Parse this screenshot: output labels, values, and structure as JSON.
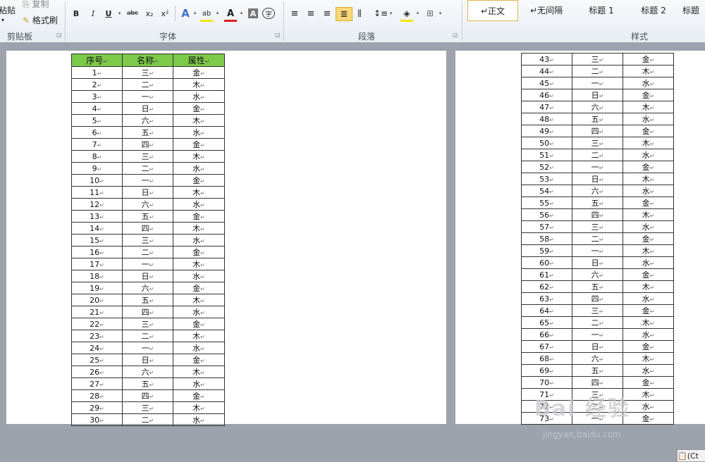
{
  "ribbon": {
    "clipboard": {
      "paste_label": "粘贴",
      "copy_label": "复制",
      "format_painter_label": "格式刷",
      "group_label": "剪贴板"
    },
    "font": {
      "group_label": "字体",
      "bold": "B",
      "italic": "I",
      "underline": "U",
      "strike": "abc",
      "subscript": "x₂",
      "superscript": "x²",
      "font_color": "A",
      "char_shading": "A",
      "enclose": "字"
    },
    "paragraph": {
      "group_label": "段落"
    },
    "styles": {
      "group_label": "样式",
      "items": [
        "↵正文",
        "↵无间隔",
        "标题 1",
        "标题 2",
        "标题"
      ]
    }
  },
  "table_left": {
    "headers": [
      "序号",
      "名称",
      "属性"
    ],
    "rows": [
      [
        "1",
        "三",
        "金"
      ],
      [
        "2",
        "二",
        "木"
      ],
      [
        "3",
        "一",
        "水"
      ],
      [
        "4",
        "日",
        "金"
      ],
      [
        "5",
        "六",
        "木"
      ],
      [
        "6",
        "五",
        "水"
      ],
      [
        "7",
        "四",
        "金"
      ],
      [
        "8",
        "三",
        "木"
      ],
      [
        "9",
        "二",
        "水"
      ],
      [
        "10",
        "一",
        "金"
      ],
      [
        "11",
        "日",
        "木"
      ],
      [
        "12",
        "六",
        "水"
      ],
      [
        "13",
        "五",
        "金"
      ],
      [
        "14",
        "四",
        "木"
      ],
      [
        "15",
        "三",
        "水"
      ],
      [
        "16",
        "二",
        "金"
      ],
      [
        "17",
        "一",
        "木"
      ],
      [
        "18",
        "日",
        "水"
      ],
      [
        "19",
        "六",
        "金"
      ],
      [
        "20",
        "五",
        "木"
      ],
      [
        "21",
        "四",
        "水"
      ],
      [
        "22",
        "三",
        "金"
      ],
      [
        "23",
        "二",
        "木"
      ],
      [
        "24",
        "一",
        "水"
      ],
      [
        "25",
        "日",
        "金"
      ],
      [
        "26",
        "六",
        "木"
      ],
      [
        "27",
        "五",
        "水"
      ],
      [
        "28",
        "四",
        "金"
      ],
      [
        "29",
        "三",
        "木"
      ],
      [
        "30",
        "二",
        "水"
      ]
    ]
  },
  "table_right": {
    "rows": [
      [
        "43",
        "三",
        "金"
      ],
      [
        "44",
        "二",
        "木"
      ],
      [
        "45",
        "一",
        "水"
      ],
      [
        "46",
        "日",
        "金"
      ],
      [
        "47",
        "六",
        "木"
      ],
      [
        "48",
        "五",
        "水"
      ],
      [
        "49",
        "四",
        "金"
      ],
      [
        "50",
        "三",
        "木"
      ],
      [
        "51",
        "二",
        "水"
      ],
      [
        "52",
        "一",
        "金"
      ],
      [
        "53",
        "日",
        "木"
      ],
      [
        "54",
        "六",
        "水"
      ],
      [
        "55",
        "五",
        "金"
      ],
      [
        "56",
        "四",
        "木"
      ],
      [
        "57",
        "三",
        "水"
      ],
      [
        "58",
        "二",
        "金"
      ],
      [
        "59",
        "一",
        "木"
      ],
      [
        "60",
        "日",
        "水"
      ],
      [
        "61",
        "六",
        "金"
      ],
      [
        "62",
        "五",
        "木"
      ],
      [
        "63",
        "四",
        "水"
      ],
      [
        "64",
        "三",
        "金"
      ],
      [
        "65",
        "二",
        "木"
      ],
      [
        "66",
        "一",
        "水"
      ],
      [
        "67",
        "日",
        "金"
      ],
      [
        "68",
        "六",
        "木"
      ],
      [
        "69",
        "五",
        "水"
      ],
      [
        "70",
        "四",
        "金"
      ],
      [
        "71",
        "三",
        "木"
      ],
      [
        "72",
        "二",
        "水"
      ],
      [
        "73",
        "一",
        "金"
      ]
    ]
  },
  "paragraph_mark": "↵",
  "watermark": "Bai 经验",
  "watermark_url": "jingyan.baidu.com",
  "paste_options_label": "(Ct"
}
